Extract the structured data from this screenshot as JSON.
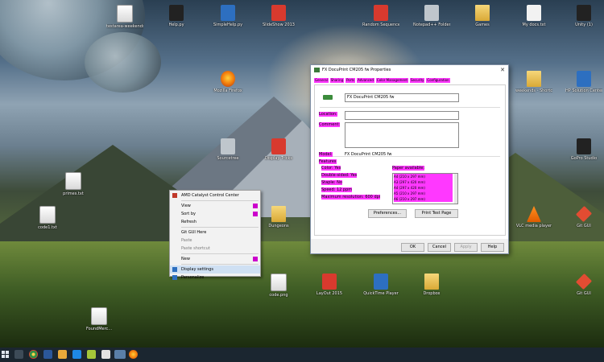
{
  "desktop": {
    "icons": [
      {
        "label": "testarea-weekends.txt",
        "kind": "doc"
      },
      {
        "label": "Help.py",
        "kind": "dark"
      },
      {
        "label": "SimpleHelp.py",
        "kind": "blue"
      },
      {
        "label": "SlideShow 2013",
        "kind": "red"
      },
      {
        "label": "Random Sequence",
        "kind": "red"
      },
      {
        "label": "Notepad++ Folder",
        "kind": "grey"
      },
      {
        "label": "Games",
        "kind": "folder"
      },
      {
        "label": "My docs.txt",
        "kind": "white"
      },
      {
        "label": "Unity (1)",
        "kind": "dark"
      },
      {
        "label": "Mozilla Firefox",
        "kind": "orange"
      },
      {
        "label": "weekends - Shortcut",
        "kind": "folder"
      },
      {
        "label": "HP Solution Center",
        "kind": "blue"
      },
      {
        "label": "Sourcetree",
        "kind": "grey"
      },
      {
        "label": "Display Tricks",
        "kind": "red"
      },
      {
        "label": "GoPro Studio",
        "kind": "dark"
      },
      {
        "label": "primes.txt",
        "kind": "doc"
      },
      {
        "label": "code1.txt",
        "kind": "doc"
      },
      {
        "label": "Dungeons",
        "kind": "folder"
      },
      {
        "label": "VLC media player",
        "kind": "cone"
      },
      {
        "label": "Git GUI",
        "kind": "git"
      },
      {
        "label": "code.png",
        "kind": "doc"
      },
      {
        "label": "LayOut 2015",
        "kind": "red"
      },
      {
        "label": "QuickTime Player",
        "kind": "blue"
      },
      {
        "label": "Dropbox",
        "kind": "folder"
      },
      {
        "label": "Git GUI",
        "kind": "git"
      },
      {
        "label": "FoundMerc...",
        "kind": "doc"
      }
    ]
  },
  "context_menu": {
    "items": [
      {
        "label": "AMD Catalyst Control Center",
        "type": "item"
      },
      {
        "type": "sep"
      },
      {
        "label": "View",
        "type": "item",
        "submenu": true
      },
      {
        "label": "Sort by",
        "type": "item",
        "submenu": true
      },
      {
        "label": "Refresh",
        "type": "item"
      },
      {
        "type": "sep"
      },
      {
        "label": "Git GUI Here",
        "type": "item"
      },
      {
        "label": "Paste",
        "type": "item",
        "disabled": true
      },
      {
        "label": "Paste shortcut",
        "type": "item",
        "disabled": true
      },
      {
        "type": "sep"
      },
      {
        "label": "New",
        "type": "item",
        "submenu": true
      },
      {
        "type": "sep"
      },
      {
        "label": "Display settings",
        "type": "item",
        "highlighted": true
      },
      {
        "label": "Personalize",
        "type": "item"
      }
    ]
  },
  "dialog": {
    "title": "FX DocuPrint CM205 fw Properties",
    "close": "✕",
    "tabs": [
      "General",
      "Sharing",
      "Ports",
      "Advanced",
      "Color Management",
      "Security",
      "Configuration"
    ],
    "printer_name": "FX DocuPrint CM205 fw",
    "location_label": "Location:",
    "location_value": "",
    "comment_label": "Comment:",
    "comment_value": "",
    "model_label": "Model:",
    "model_value": "FX DocuPrint CM205 fw",
    "features_label": "Features",
    "features": {
      "color": "Color: Yes",
      "double_sided": "Double-sided: Yes",
      "staple": "Staple: No",
      "speed": "Speed: 12 ppm",
      "max_resolution": "Maximum resolution: 600 dpi",
      "paper_label": "Paper available:",
      "paper": [
        "A4 (210 x 297 mm)",
        "A3 (297 x 420 mm)",
        "A4 (297 x 420 mm)",
        "A5 (210 x 297 mm)",
        "A6 (210 x 297 mm)"
      ]
    },
    "preferences_button": "Preferences...",
    "print_test_button": "Print Test Page",
    "ok_button": "OK",
    "cancel_button": "Cancel",
    "apply_button": "Apply",
    "help_button": "Help"
  },
  "colors": {
    "highlight": "#ff38ff",
    "taskbar": "#1b2630"
  }
}
